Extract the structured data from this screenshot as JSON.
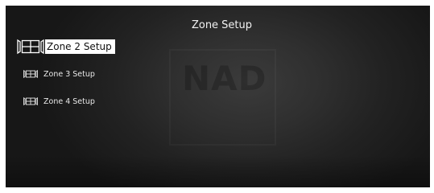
{
  "screen": {
    "title": "Zone Setup",
    "watermark": "NAD"
  },
  "menu": {
    "items": [
      {
        "label": "Zone 2 Setup",
        "icon": "zone-icon",
        "selected": true
      },
      {
        "label": "Zone 3 Setup",
        "icon": "zone-icon",
        "selected": false
      },
      {
        "label": "Zone 4 Setup",
        "icon": "zone-icon",
        "selected": false
      }
    ]
  },
  "colors": {
    "background": "#2b2b2b",
    "text": "#e8e8e8",
    "highlight": "#ffffff",
    "highlight_text": "#111111"
  }
}
